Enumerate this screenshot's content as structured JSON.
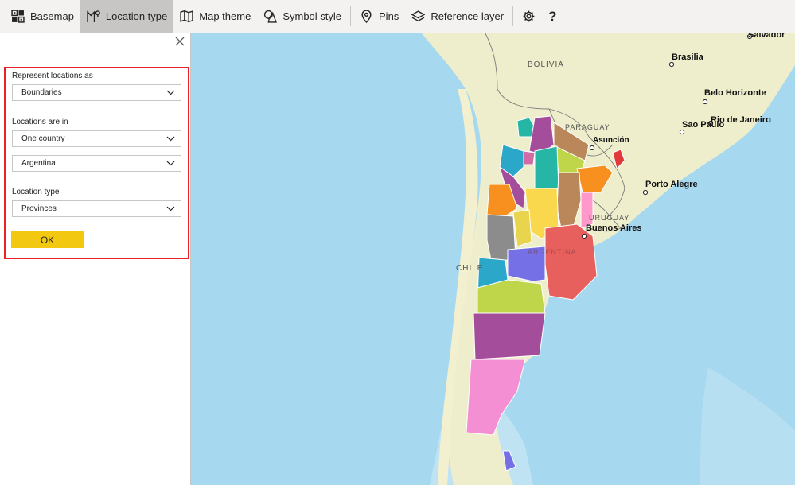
{
  "toolbar": {
    "items": [
      {
        "label": "Basemap",
        "icon": "basemap-icon"
      },
      {
        "label": "Location type",
        "icon": "location-type-icon",
        "active": true
      },
      {
        "label": "Map theme",
        "icon": "map-theme-icon"
      },
      {
        "label": "Symbol style",
        "icon": "symbol-style-icon"
      },
      {
        "label": "Pins",
        "icon": "pin-icon"
      },
      {
        "label": "Reference layer",
        "icon": "layers-icon"
      }
    ],
    "settings_icon": "gear-icon",
    "help_label": "?"
  },
  "pane": {
    "close_icon": "close-icon",
    "represent_label": "Represent locations as",
    "represent_value": "Boundaries",
    "locations_in_label": "Locations are in",
    "locations_in_value": "One country",
    "country_value": "Argentina",
    "location_type_label": "Location type",
    "location_type_value": "Provinces",
    "ok_label": "OK",
    "highlight_color": "#e8202a",
    "ok_color": "#f2c811"
  },
  "map": {
    "colors": {
      "ocean": "#a6d8ef",
      "land": "#eeeecc",
      "border": "#7a7a7a"
    },
    "place_labels": {
      "salvador": "Salvador",
      "bolivia": "BOLIVIA",
      "brasilia": "Brasilia",
      "belo_horizonte": "Belo Horizonte",
      "paraguay": "PARAGUAY",
      "rio": "Rio de Janeiro",
      "sao_paulo": "Sao Paulo",
      "asuncion": "Asunción",
      "porto_alegre": "Porto Alegre",
      "uruguay": "URUGUAY",
      "buenos_aires": "Buenos Aires",
      "chile": "CHILE",
      "argentina": "ARGENTINA"
    },
    "province_colors": [
      "#d16ba5",
      "#a44d9a",
      "#2ba8c9",
      "#26b6a6",
      "#bfd64b",
      "#b9875a",
      "#f7901e",
      "#e8d44d",
      "#ff99cc",
      "#8c8c8c",
      "#7570e6",
      "#e8605e",
      "#e03a3a"
    ]
  }
}
